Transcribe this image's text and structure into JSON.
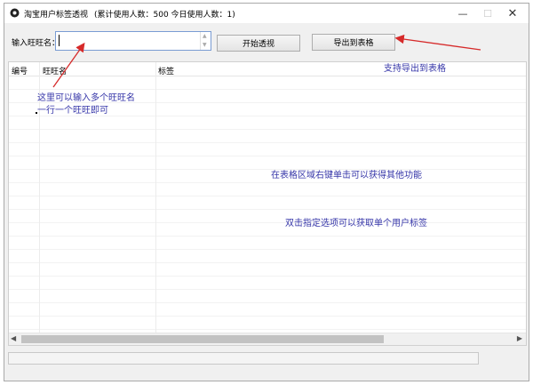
{
  "window": {
    "title": "淘宝用户标签透视",
    "stats": "(累计使用人数：500   今日使用人数：1)",
    "controls": {
      "minimize": "—",
      "maximize": "☐",
      "close": "✕"
    }
  },
  "toolbar": {
    "input_label": "输入旺旺名：",
    "input_value": "",
    "start_button": "开始透视",
    "export_button": "导出到表格"
  },
  "table": {
    "columns": [
      "编号",
      "旺旺名",
      "标签"
    ],
    "rows": []
  },
  "annotations": {
    "input_hint_line1": "这里可以输入多个旺旺名",
    "input_hint_line2": "一行一个旺旺即可",
    "export_hint": "支持导出到表格",
    "right_click_hint": "在表格区域右键单击可以获得其他功能",
    "double_click_hint": "双击指定选项可以获取单个用户标签"
  },
  "colors": {
    "annotation": "#3535a8",
    "arrow": "#d62a2a"
  }
}
